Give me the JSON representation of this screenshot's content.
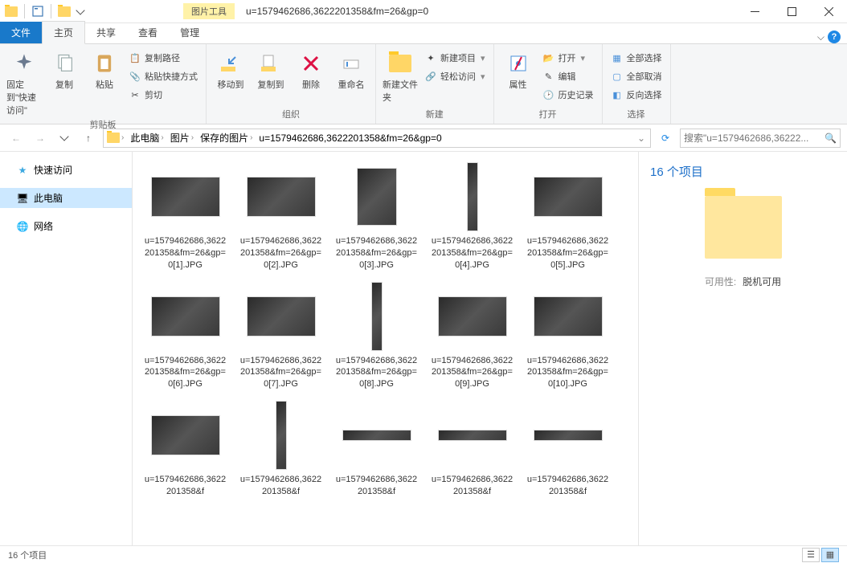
{
  "window": {
    "title": "u=1579462686,3622201358&fm=26&gp=0",
    "contextual_tab": "图片工具"
  },
  "tabs": {
    "file": "文件",
    "home": "主页",
    "share": "共享",
    "view": "查看",
    "manage": "管理"
  },
  "ribbon": {
    "pin": "固定到\"快速访问\"",
    "copy": "复制",
    "paste": "粘贴",
    "copypath": "复制路径",
    "pasteshortcut": "粘贴快捷方式",
    "cut": "剪切",
    "clipboard": "剪贴板",
    "moveto": "移动到",
    "copyto": "复制到",
    "delete": "删除",
    "rename": "重命名",
    "organize": "组织",
    "newfolder": "新建文件夹",
    "newitem": "新建项目",
    "easyaccess": "轻松访问",
    "new": "新建",
    "properties": "属性",
    "open": "打开",
    "edit": "编辑",
    "history": "历史记录",
    "open_group": "打开",
    "selectall": "全部选择",
    "selectnone": "全部取消",
    "invertsel": "反向选择",
    "select": "选择"
  },
  "breadcrumb": {
    "pc": "此电脑",
    "pictures": "图片",
    "saved": "保存的图片",
    "folder": "u=1579462686,3622201358&fm=26&gp=0"
  },
  "search": {
    "placeholder": "搜索\"u=1579462686,36222..."
  },
  "sidebar": {
    "quick": "快速访问",
    "pc": "此电脑",
    "network": "网络"
  },
  "files": [
    {
      "name": "u=1579462686,3622201358&fm=26&gp=0[1].JPG",
      "s": "wide"
    },
    {
      "name": "u=1579462686,3622201358&fm=26&gp=0[2].JPG",
      "s": "wide"
    },
    {
      "name": "u=1579462686,3622201358&fm=26&gp=0[3].JPG",
      "s": "mid"
    },
    {
      "name": "u=1579462686,3622201358&fm=26&gp=0[4].JPG",
      "s": "tall"
    },
    {
      "name": "u=1579462686,3622201358&fm=26&gp=0[5].JPG",
      "s": "wide"
    },
    {
      "name": "u=1579462686,3622201358&fm=26&gp=0[6].JPG",
      "s": "wide"
    },
    {
      "name": "u=1579462686,3622201358&fm=26&gp=0[7].JPG",
      "s": "wide"
    },
    {
      "name": "u=1579462686,3622201358&fm=26&gp=0[8].JPG",
      "s": "tall"
    },
    {
      "name": "u=1579462686,3622201358&fm=26&gp=0[9].JPG",
      "s": "wide"
    },
    {
      "name": "u=1579462686,3622201358&fm=26&gp=0[10].JPG",
      "s": "wide"
    },
    {
      "name": "u=1579462686,3622201358&f",
      "s": "wide"
    },
    {
      "name": "u=1579462686,3622201358&f",
      "s": "tall"
    },
    {
      "name": "u=1579462686,3622201358&f",
      "s": "short"
    },
    {
      "name": "u=1579462686,3622201358&f",
      "s": "short"
    },
    {
      "name": "u=1579462686,3622201358&f",
      "s": "short"
    }
  ],
  "details": {
    "title": "16 个项目",
    "avail_k": "可用性:",
    "avail_v": "脱机可用"
  },
  "status": {
    "count": "16 个项目"
  }
}
